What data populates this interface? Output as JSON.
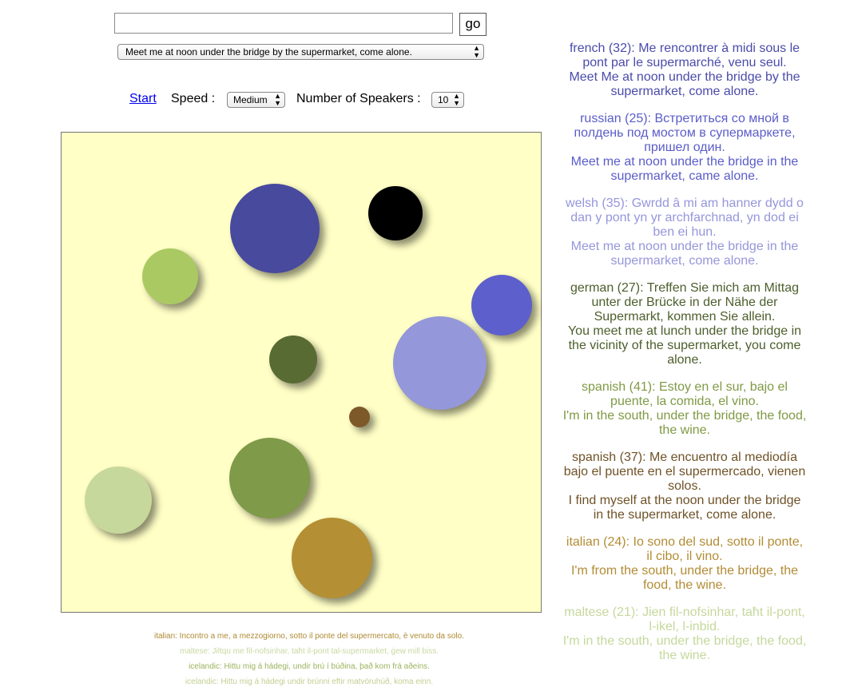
{
  "search": {
    "value": "",
    "placeholder": "",
    "go_label": "go"
  },
  "phrase_select": {
    "selected": "Meet me at noon under the bridge by the supermarket, come alone."
  },
  "controls": {
    "start_label": "Start",
    "speed_label": "Speed :",
    "speed_selected": "Medium",
    "speakers_label": "Number of Speakers :",
    "speakers_selected": "10"
  },
  "speakers": [
    {
      "color": "#484a9e",
      "shape": "circle"
    },
    {
      "color": "#000000",
      "shape": "circle"
    },
    {
      "color": "#abc963",
      "shape": "circle"
    },
    {
      "color": "#5d5fcc",
      "shape": "circle"
    },
    {
      "color": "#586b33",
      "shape": "circle"
    },
    {
      "color": "#9497d9",
      "shape": "circle"
    },
    {
      "color": "#7d5829",
      "shape": "circle"
    },
    {
      "color": "#7f9a49",
      "shape": "circle"
    },
    {
      "color": "#c6d89b",
      "shape": "circle"
    },
    {
      "color": "#b48f34",
      "shape": "circle"
    }
  ],
  "log_lines": [
    {
      "text": "italian: Incontro a me, a mezzogiorno, sotto il ponte del supermercato, è venuto da solo.",
      "color": "#b08a33"
    },
    {
      "text": "maltese: Jiltqu me fil-nofsinhar, taħt il-pont tal-supermarket, ġew mill biss.",
      "color": "#c7d9a0"
    },
    {
      "text": "icelandic: Hittu mig á hádegi, undir brú í búðina, það kom frá aðeins.",
      "color": "#9bb35c"
    },
    {
      "text": "icelandic: Hittu mig á hádegi undir brúnni eftir matvöruhúð, koma einn.",
      "color": "#c2cf91"
    }
  ],
  "translations": [
    {
      "lang_line": "french (32): Me rencontrer à midi sous le pont par le supermarché, venu seul.",
      "english": "Meet Me at noon under the bridge by the supermarket, come alone.",
      "color": "#4a4bab"
    },
    {
      "lang_line": "russian (25): Встретиться со мной в полдень под мостом в супермаркете, пришел один.",
      "english": "Meet me at noon under the bridge in the supermarket, came alone.",
      "color": "#5a5cc9"
    },
    {
      "lang_line": "welsh (35): Gwrdd â mi am hanner dydd o dan y pont yn yr archfarchnad, yn dod ei ben ei hun.",
      "english": "Meet me at noon under the bridge in the supermarket, come alone.",
      "color": "#9596db"
    },
    {
      "lang_line": "german (27): Treffen Sie mich am Mittag unter der Brücke in der Nähe der Supermarkt, kommen Sie allein.",
      "english": "You meet me at lunch under the bridge in the vicinity of the supermarket, you come alone.",
      "color": "#4c5f2c"
    },
    {
      "lang_line": "spanish (41): Estoy en el sur, bajo el puente, la comida, el vino.",
      "english": "I'm in the south, under the bridge, the food, the wine.",
      "color": "#7f9a45"
    },
    {
      "lang_line": "spanish (37): Me encuentro al mediodía bajo el puente en el supermercado, vienen solos.",
      "english": "I find myself at the noon under the bridge in the supermarket, come alone.",
      "color": "#6f5227"
    },
    {
      "lang_line": "italian (24): Io sono del sud, sotto il ponte, il cibo, il vino.",
      "english": "I'm from the south, under the bridge, the food, the wine.",
      "color": "#b28c35"
    },
    {
      "lang_line": "maltese (21): Jien fil-nofsinhar, taħt il-pont, l-ikel, l-inbid.",
      "english": "I'm in the south, under the bridge, the food, the wine.",
      "color": "#c5d89c"
    }
  ]
}
